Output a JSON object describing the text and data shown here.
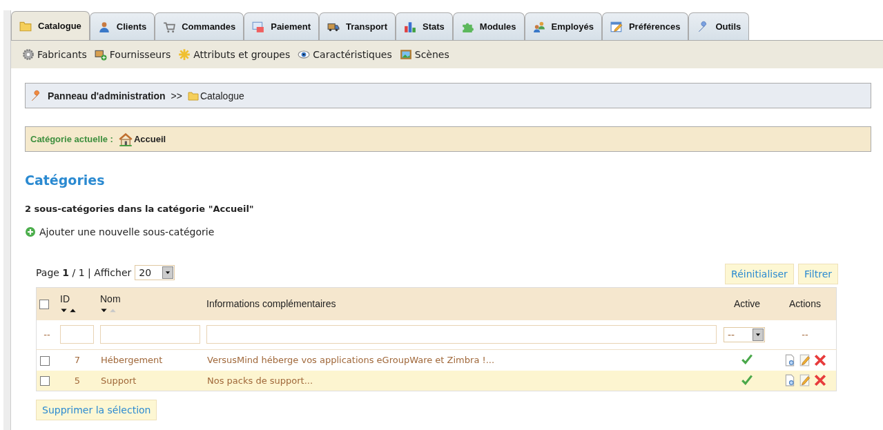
{
  "tabs": [
    {
      "label": "Catalogue",
      "selected": true
    },
    {
      "label": "Clients",
      "selected": false
    },
    {
      "label": "Commandes",
      "selected": false
    },
    {
      "label": "Paiement",
      "selected": false
    },
    {
      "label": "Transport",
      "selected": false
    },
    {
      "label": "Stats",
      "selected": false
    },
    {
      "label": "Modules",
      "selected": false
    },
    {
      "label": "Employés",
      "selected": false
    },
    {
      "label": "Préférences",
      "selected": false
    },
    {
      "label": "Outils",
      "selected": false
    }
  ],
  "subnav": [
    "Fabricants",
    "Fournisseurs",
    "Attributs et groupes",
    "Caractéristiques",
    "Scènes"
  ],
  "breadcrumb": {
    "root": "Panneau d'administration",
    "separator": ">>",
    "current": "Catalogue"
  },
  "current_category": {
    "label": "Catégorie actuelle :",
    "value": "Accueil"
  },
  "heading": "Catégories",
  "subtitle": "2 sous-catégories dans la catégorie \"Accueil\"",
  "add_link": "Ajouter une nouvelle sous-catégorie",
  "pagination": {
    "text": "Page **1** / 1 | Afficher",
    "per_page": "20"
  },
  "filter_buttons": [
    "Réinitialiser",
    "Filtrer"
  ],
  "table": {
    "select_all_checked": false,
    "columns": [
      "ID",
      "Nom",
      "Informations complémentaires",
      "Active",
      "Actions"
    ],
    "filter": {
      "dash": "--",
      "active": "--",
      "actions": "--"
    },
    "rows": [
      {
        "checked": false,
        "id": "7",
        "name": "Hébergement",
        "info": "VersusMind héberge vos applications eGroupWare et Zimbra !...",
        "active": true
      },
      {
        "checked": false,
        "id": "5",
        "name": "Support",
        "info": "Nos packs de support...",
        "active": true
      }
    ]
  },
  "delete_button": "Supprimer la sélection"
}
